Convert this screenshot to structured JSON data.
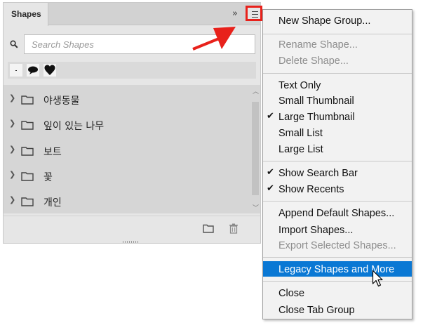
{
  "panel": {
    "tab_label": "Shapes",
    "collapse_glyph": "»",
    "search_placeholder": "Search Shapes",
    "groups": [
      {
        "label": "야생동물"
      },
      {
        "label": "잎이 있는 나무"
      },
      {
        "label": "보트"
      },
      {
        "label": "꽃"
      },
      {
        "label": "개인"
      }
    ],
    "recent_shapes": [
      "dot",
      "speech-bubble",
      "heart"
    ]
  },
  "menu": {
    "items": [
      {
        "label": "New Shape Group...",
        "enabled": true,
        "checked": false
      },
      {
        "label": "Rename Shape...",
        "enabled": false,
        "checked": false
      },
      {
        "label": "Delete Shape...",
        "enabled": false,
        "checked": false
      },
      {
        "label": "Text Only",
        "enabled": true,
        "checked": false
      },
      {
        "label": "Small Thumbnail",
        "enabled": true,
        "checked": false
      },
      {
        "label": "Large Thumbnail",
        "enabled": true,
        "checked": true
      },
      {
        "label": "Small List",
        "enabled": true,
        "checked": false
      },
      {
        "label": "Large List",
        "enabled": true,
        "checked": false
      },
      {
        "label": "Show Search Bar",
        "enabled": true,
        "checked": true
      },
      {
        "label": "Show Recents",
        "enabled": true,
        "checked": true
      },
      {
        "label": "Append Default Shapes...",
        "enabled": true,
        "checked": false
      },
      {
        "label": "Import Shapes...",
        "enabled": true,
        "checked": false
      },
      {
        "label": "Export Selected Shapes...",
        "enabled": false,
        "checked": false
      },
      {
        "label": "Legacy Shapes and More",
        "enabled": true,
        "checked": false,
        "highlighted": true
      },
      {
        "label": "Close",
        "enabled": true,
        "checked": false
      },
      {
        "label": "Close Tab Group",
        "enabled": true,
        "checked": false
      }
    ],
    "check_glyph": "✔"
  },
  "colors": {
    "highlight": "#0a78d4",
    "annotation_red": "#e8211b"
  },
  "icons": {
    "panel_menu": "hamburger-menu-icon",
    "search": "search-icon",
    "folder": "folder-icon",
    "new_group": "new-group-folder-icon",
    "delete": "trash-icon",
    "cursor": "mouse-pointer-icon"
  }
}
